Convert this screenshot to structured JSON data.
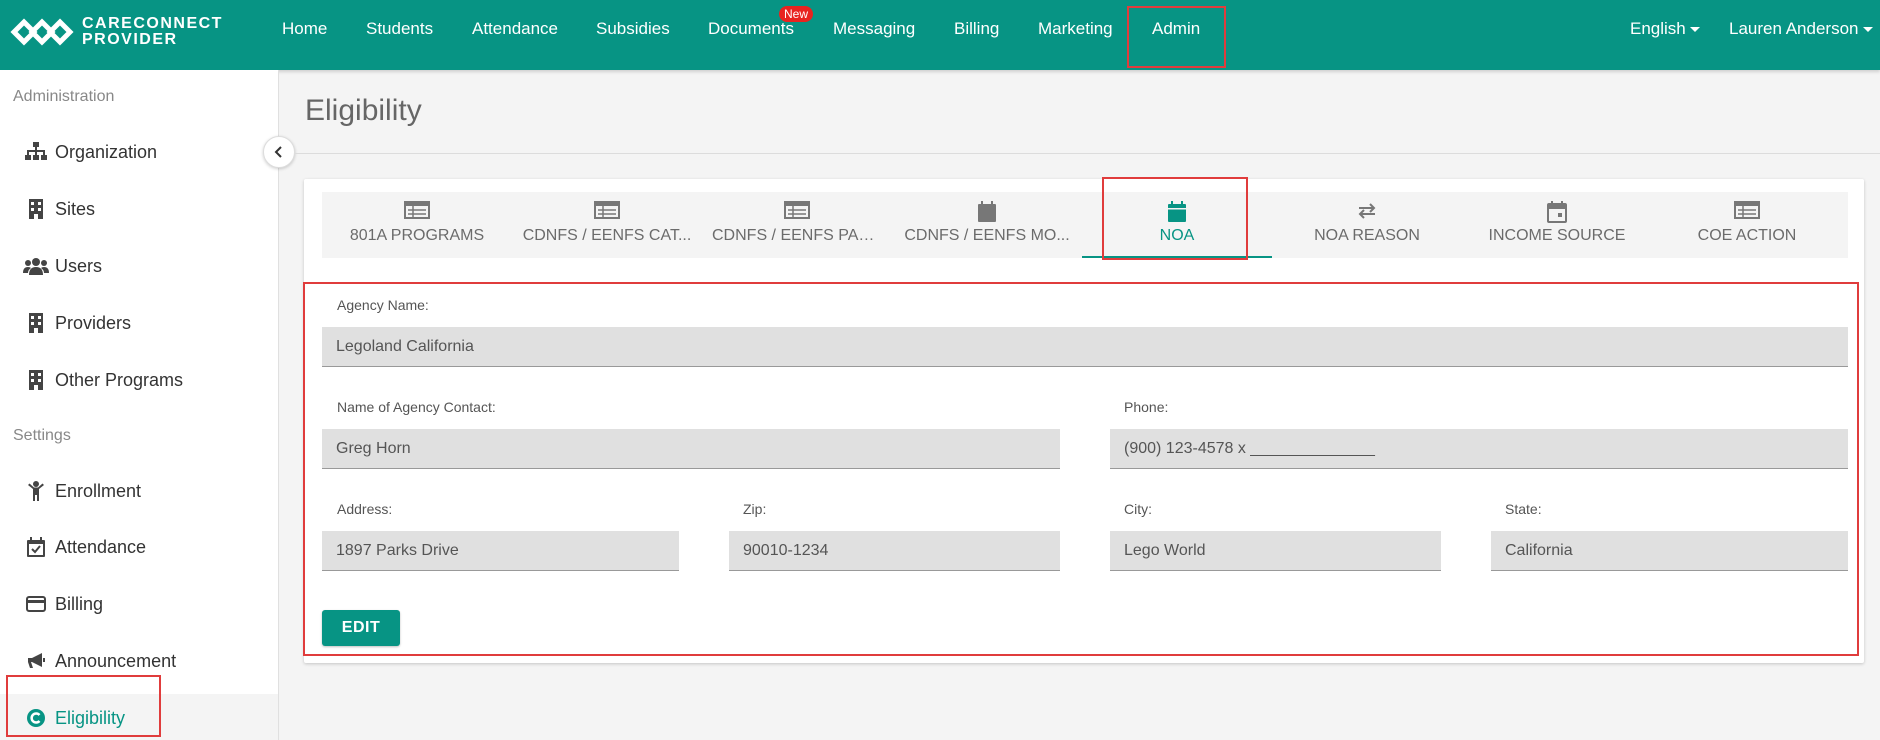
{
  "brand": {
    "line1": "CARECONNECT",
    "line2": "PROVIDER"
  },
  "topnav": {
    "items": [
      "Home",
      "Students",
      "Attendance",
      "Subsidies",
      "Documents",
      "Messaging",
      "Billing",
      "Marketing",
      "Admin"
    ],
    "documents_badge": "New",
    "language": "English",
    "user": "Lauren Anderson",
    "active": "Admin"
  },
  "sidebar": {
    "admin_heading": "Administration",
    "admin_items": [
      {
        "label": "Organization",
        "icon": "sitemap-icon"
      },
      {
        "label": "Sites",
        "icon": "building-icon"
      },
      {
        "label": "Users",
        "icon": "users-icon"
      },
      {
        "label": "Providers",
        "icon": "building-icon"
      },
      {
        "label": "Other Programs",
        "icon": "building-icon"
      }
    ],
    "settings_heading": "Settings",
    "settings_items": [
      {
        "label": "Enrollment",
        "icon": "child-icon"
      },
      {
        "label": "Attendance",
        "icon": "calendar-check-icon"
      },
      {
        "label": "Billing",
        "icon": "credit-card-icon"
      },
      {
        "label": "Announcement",
        "icon": "bullhorn-icon"
      },
      {
        "label": "Eligibility",
        "icon": "eligibility-c-icon",
        "active": true
      }
    ]
  },
  "page": {
    "title": "Eligibility"
  },
  "tabs": [
    {
      "label": "801A PROGRAMS",
      "icon": "table-icon"
    },
    {
      "label": "CDNFS / EENFS CAT...",
      "icon": "table-icon"
    },
    {
      "label": "CDNFS / EENFS PAR...",
      "icon": "table-icon"
    },
    {
      "label": "CDNFS / EENFS MO...",
      "icon": "calendar-icon"
    },
    {
      "label": "NOA",
      "icon": "calendar-icon",
      "active": true
    },
    {
      "label": "NOA REASON",
      "icon": "exchange-icon"
    },
    {
      "label": "INCOME SOURCE",
      "icon": "calendar-icon"
    },
    {
      "label": "COE ACTION",
      "icon": "table-icon"
    }
  ],
  "form": {
    "agency_name": {
      "label": "Agency Name:",
      "value": "Legoland California"
    },
    "contact": {
      "label": "Name of Agency Contact:",
      "value": "Greg Horn"
    },
    "phone": {
      "label": "Phone:",
      "value": "(900) 123-4578 x ______________"
    },
    "address": {
      "label": "Address:",
      "value": "1897 Parks Drive"
    },
    "zip": {
      "label": "Zip:",
      "value": "90010-1234"
    },
    "city": {
      "label": "City:",
      "value": "Lego World"
    },
    "state": {
      "label": "State:",
      "value": "California"
    },
    "edit_label": "EDIT"
  },
  "colors": {
    "brand": "#079484",
    "highlight": "#e03c3c",
    "badge": "#e8231f"
  }
}
